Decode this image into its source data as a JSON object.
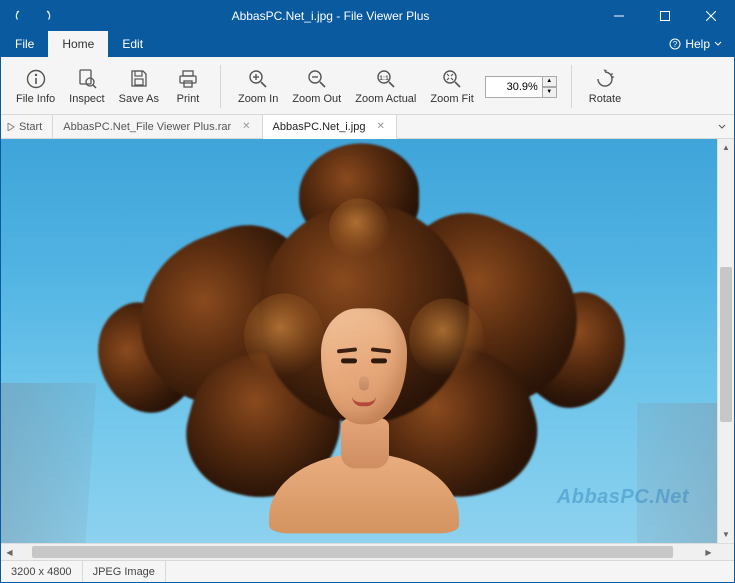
{
  "colors": {
    "primary": "#0a5aa0"
  },
  "titlebar": {
    "title": "AbbasPC.Net_i.jpg - File Viewer Plus"
  },
  "menubar": {
    "items": [
      {
        "label": "File",
        "active": false
      },
      {
        "label": "Home",
        "active": true
      },
      {
        "label": "Edit",
        "active": false
      }
    ],
    "help_label": "Help"
  },
  "ribbon": {
    "file_info": "File Info",
    "inspect": "Inspect",
    "save_as": "Save As",
    "print": "Print",
    "zoom_in": "Zoom In",
    "zoom_out": "Zoom Out",
    "zoom_actual": "Zoom Actual",
    "zoom_fit": "Zoom Fit",
    "zoom_value": "30.9%",
    "rotate": "Rotate"
  },
  "tabs": {
    "start_label": "Start",
    "items": [
      {
        "label": "AbbasPC.Net_File Viewer Plus.rar",
        "active": false
      },
      {
        "label": "AbbasPC.Net_i.jpg",
        "active": true
      }
    ]
  },
  "viewer": {
    "watermark": "AbbasPC.Net"
  },
  "statusbar": {
    "dimensions": "3200 x 4800",
    "format": "JPEG Image"
  }
}
